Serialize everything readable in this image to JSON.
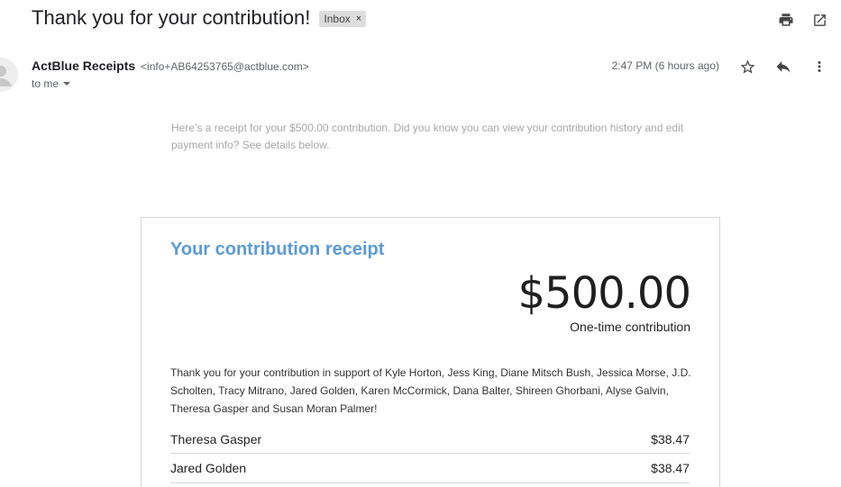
{
  "email": {
    "subject": "Thank you for your contribution!",
    "label": "Inbox",
    "label_close": "×",
    "sender_name": "ActBlue Receipts",
    "sender_email": "<info+AB64253765@actblue.com>",
    "to_label": "to me",
    "time": "2:47 PM (6 hours ago)"
  },
  "body": {
    "preheader": "Here’s a receipt for your $500.00 contribution. Did you know you can view your contribution history and edit payment info? See details below.",
    "card_title": "Your contribution receipt",
    "amount": "$500.00",
    "amount_type": "One-time contribution",
    "thanks_text": "Thank you for your contribution in support of Kyle Horton, Jess King, Diane Mitsch Bush, Jessica Morse, J.D. Scholten, Tracy Mitrano, Jared Golden, Karen McCormick, Dana Balter, Shireen Ghorbani, Alyse Galvin, Theresa Gasper and Susan Moran Palmer!",
    "line_items": [
      {
        "name": "Theresa Gasper",
        "amount": "$38.47"
      },
      {
        "name": "Jared Golden",
        "amount": "$38.47"
      }
    ]
  },
  "icons": {
    "print": "print-icon",
    "open_new": "open-in-new-window-icon",
    "star": "star-icon",
    "reply": "reply-icon",
    "more": "more-vertical-icon",
    "avatar": "default-avatar-icon",
    "dropdown": "caret-down-icon"
  },
  "colors": {
    "accent": "#5b9bd5",
    "chip_bg": "#dddddd",
    "muted_text": "#a7a7a7"
  }
}
